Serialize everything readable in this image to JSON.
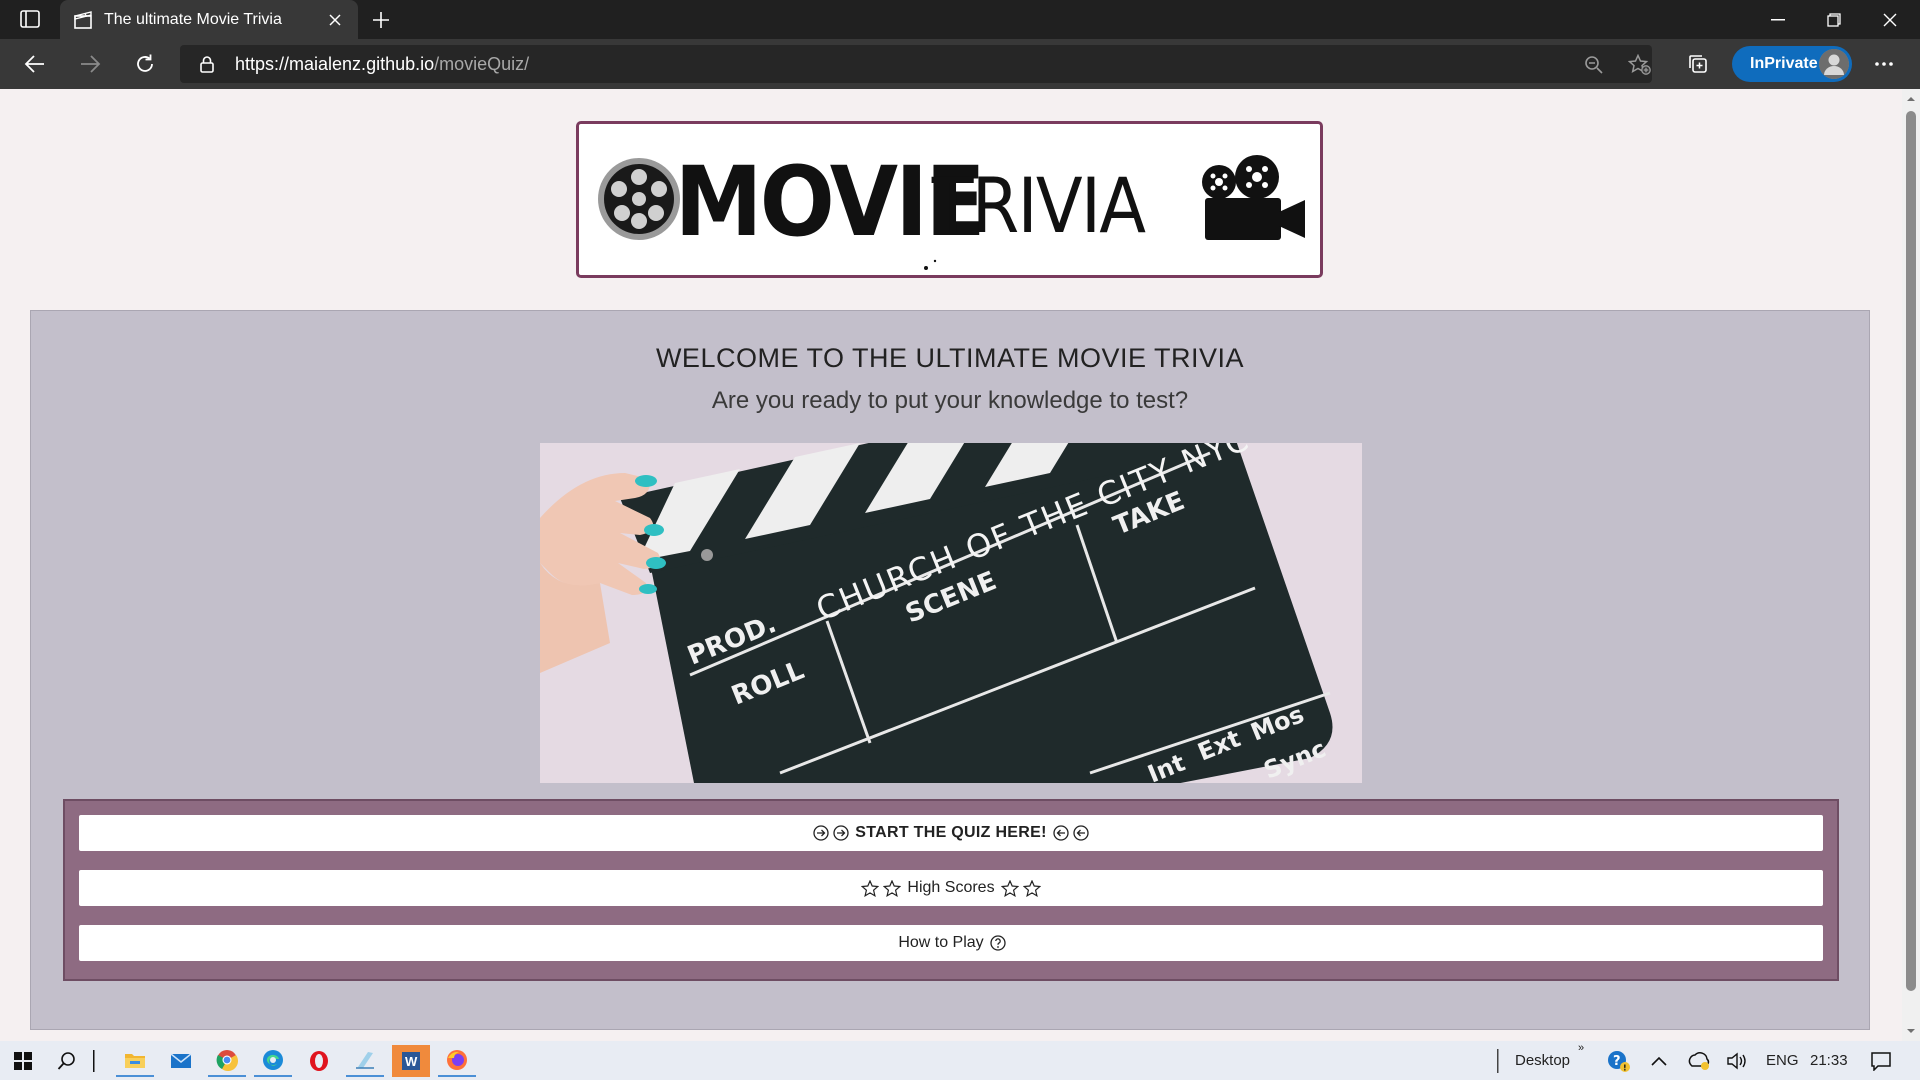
{
  "browser": {
    "tab_title": "The ultimate Movie Trivia",
    "url_host": "https://maialenz.github.io",
    "url_path": "/movieQuiz/",
    "inprivate_label": "InPrivate"
  },
  "logo": {
    "text_bold": "MOVIE",
    "text_light": "TRIVIA"
  },
  "main": {
    "welcome": "WELCOME TO THE ULTIMATE MOVIE TRIVIA",
    "subtitle": "Are you ready to put your knowledge to test?",
    "clapper": {
      "prod": "PROD.",
      "roll": "ROLL",
      "scene": "SCENE",
      "take": "TAKE",
      "title": "CHURCH OF THE CITY NYC",
      "int": "Int",
      "ext": "Ext",
      "mos": "Mos",
      "sync": "Sync"
    }
  },
  "buttons": {
    "start": "START THE QUIZ HERE!",
    "high_scores": "High Scores",
    "how_to_play": "How to Play"
  },
  "taskbar": {
    "desktop_label": "Desktop",
    "language": "ENG",
    "time": "21:33"
  },
  "colors": {
    "accent_border": "#7a3b5e",
    "card_bg": "#c3bfcb",
    "button_panel": "#8e6b82",
    "inprivate_blue": "#0f6cbd"
  }
}
